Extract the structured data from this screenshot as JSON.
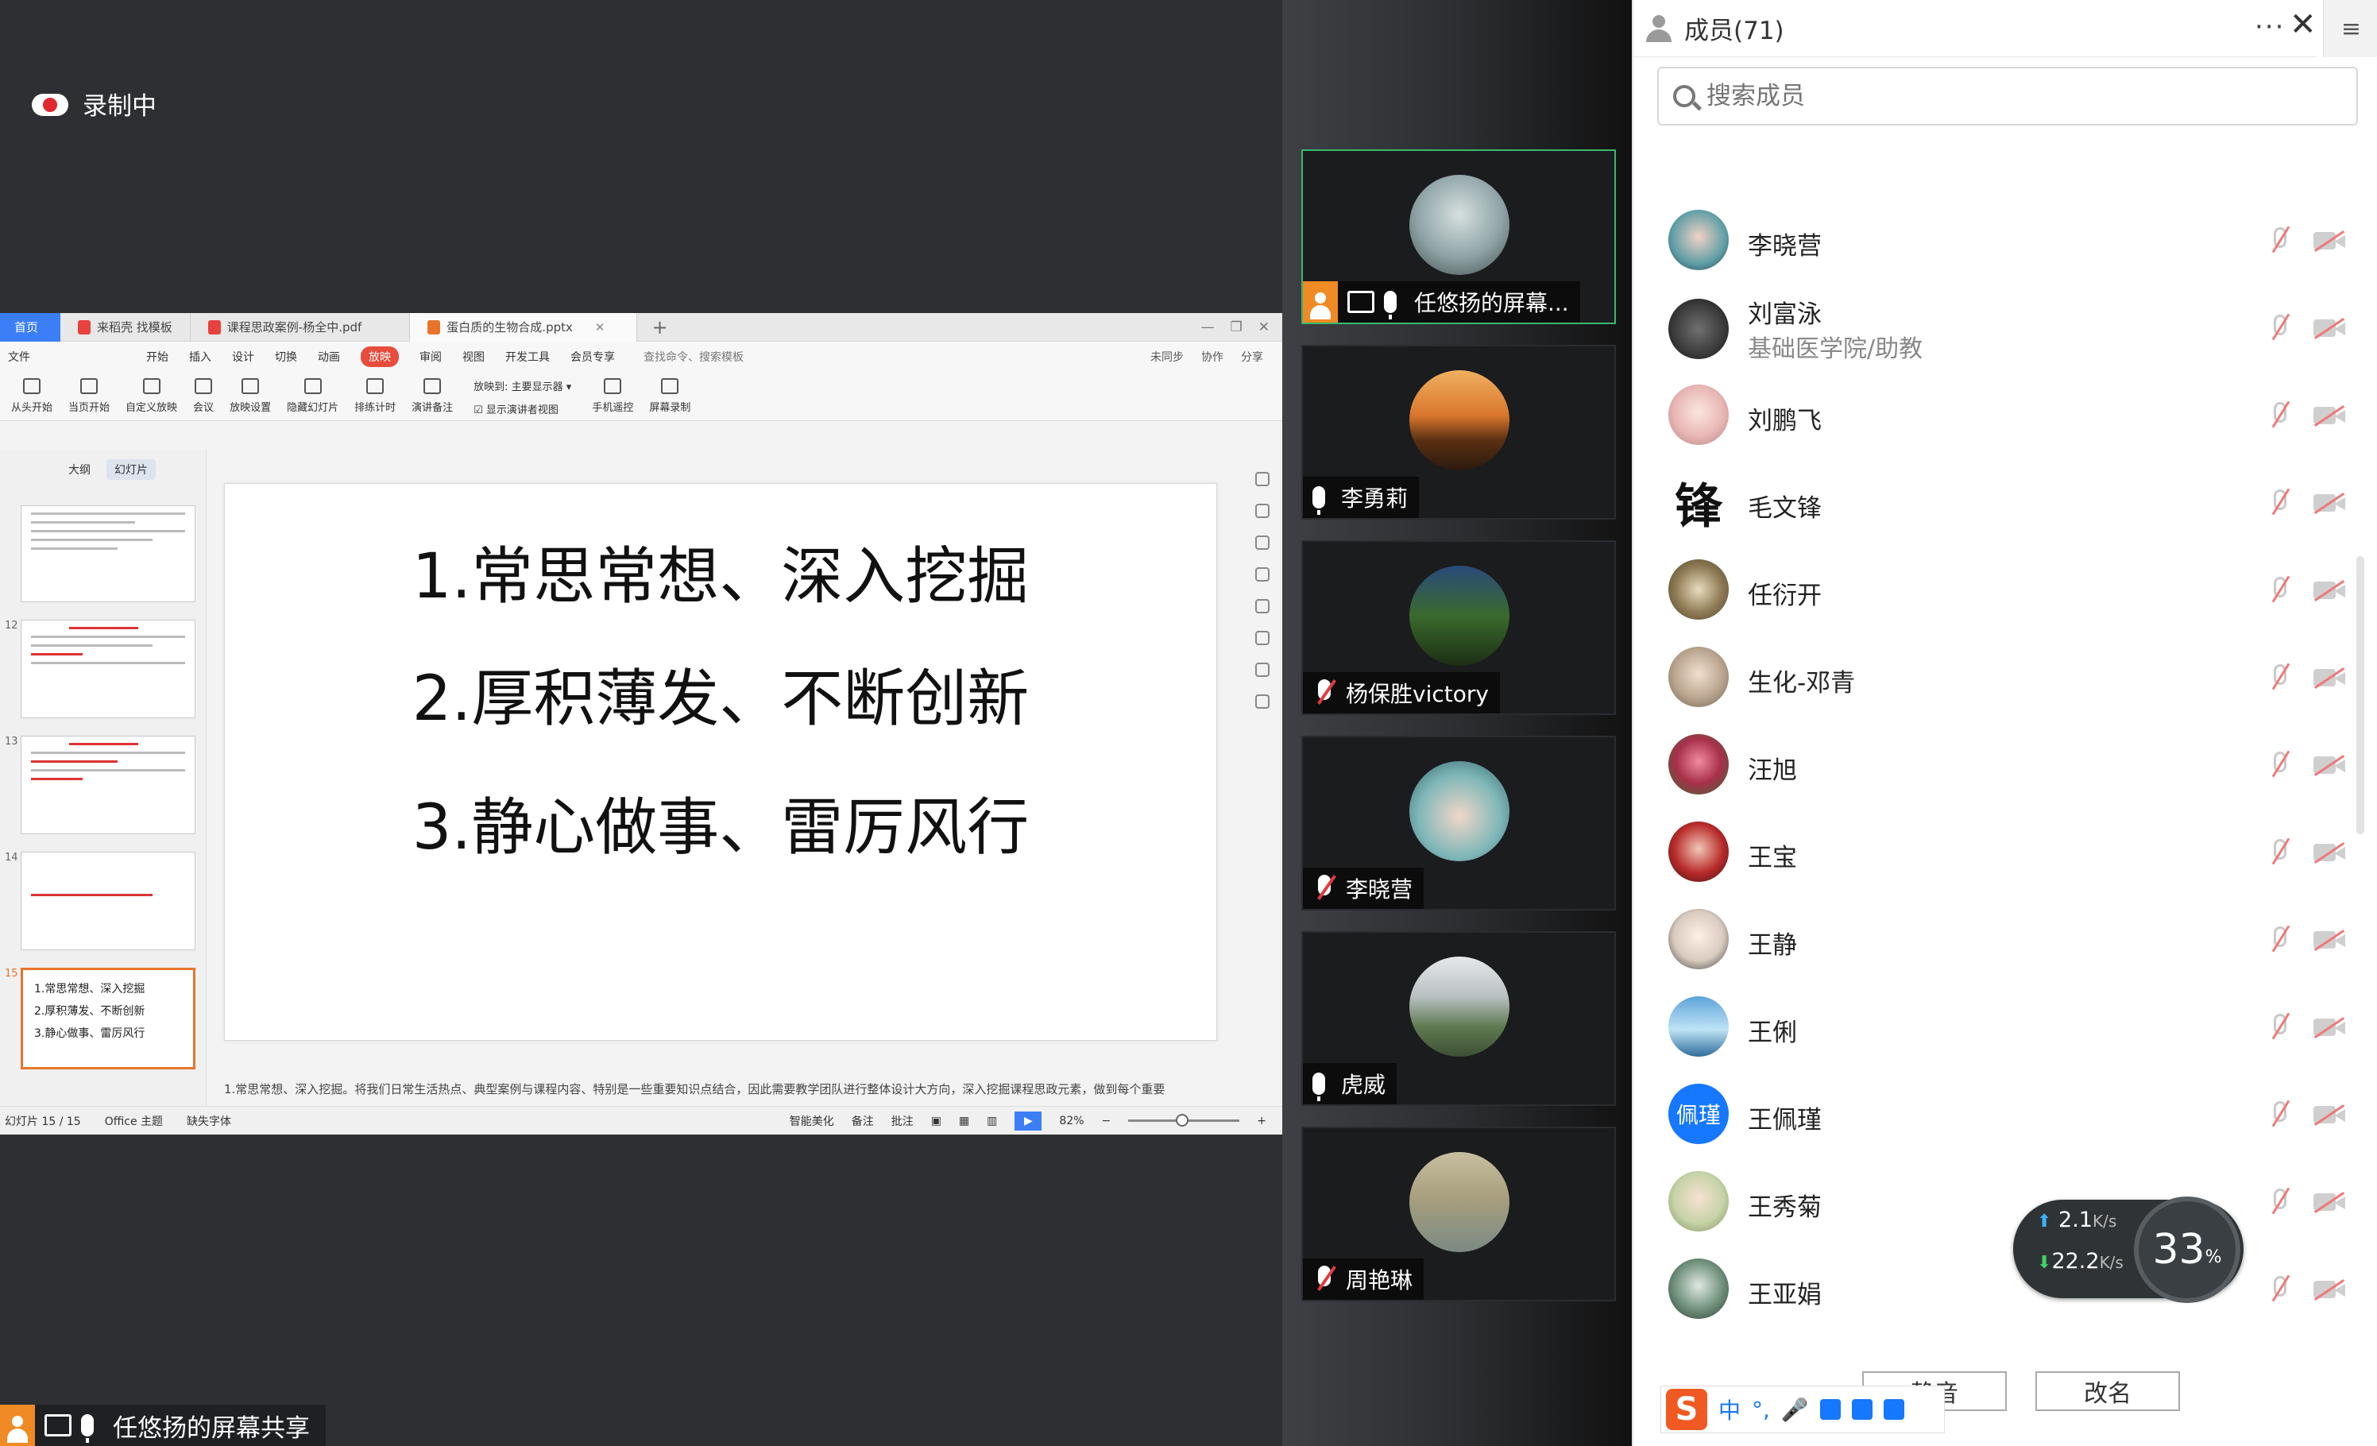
{
  "recording": {
    "label": "录制中",
    "icon": "cloud-record-icon"
  },
  "screen_share": {
    "tabs": [
      {
        "label": "首页"
      },
      {
        "label": "来稻壳 找模板",
        "icon_color": "#e8423f"
      },
      {
        "label": "课程思政案例-杨全中.pdf",
        "icon_color": "#e8423f"
      },
      {
        "label": "蛋白质的生物合成.pptx",
        "icon_color": "#e8742b"
      }
    ],
    "menu": [
      "文件",
      "开始",
      "插入",
      "设计",
      "切换",
      "动画",
      "放映",
      "审阅",
      "视图",
      "开发工具",
      "会员专享"
    ],
    "menu_selected": "放映",
    "search_cmd": "查找命令、搜索模板",
    "menu_right": [
      "未同步",
      "协作",
      "分享"
    ],
    "ribbon": [
      "从头开始",
      "当页开始",
      "自定义放映",
      "会议",
      "放映设置",
      "隐藏幻灯片",
      "排练计时",
      "演讲备注",
      "手机遥控",
      "屏幕录制"
    ],
    "ribbon_group": {
      "display_label": "放映到:",
      "display_value": "主要显示器",
      "presenter_view": "显示演讲者视图"
    },
    "pane_tabs": [
      "大纲",
      "幻灯片"
    ],
    "thumb_numbers": [
      "12",
      "13",
      "14",
      "15"
    ],
    "thumb_selected_lines": [
      "1.常思常想、深入挖掘",
      "2.厚积薄发、不断创新",
      "3.静心做事、雷厉风行"
    ],
    "slide_lines": [
      "1.常思常想、深入挖掘",
      "2.厚积薄发、不断创新",
      "3.静心做事、雷厉风行"
    ],
    "notes": "1.常思常想、深入挖掘。将我们日常生活热点、典型案例与课程内容、特别是一些重要知识点结合，因此需要教学团队进行整体设计大方向，深入挖掘课程思政元素，做到每个重要",
    "status": {
      "slide_counter": "幻灯片 15 / 15",
      "theme": "Office 主题",
      "missing_font": "缺失字体",
      "smart_beautify": "智能美化",
      "notes_label": "备注",
      "comments_label": "批注",
      "zoom": "82%"
    }
  },
  "sharer_bar": {
    "label": "任悠扬的屏幕共享"
  },
  "video_tiles": [
    {
      "name": "任悠扬的屏幕...",
      "muted": false,
      "sharing": true,
      "avatar_color": "#8ea3a6"
    },
    {
      "name": "李勇莉",
      "muted": false,
      "sharing": false,
      "avatar_color": "#d9772d"
    },
    {
      "name": "杨保胜victory",
      "muted": true,
      "sharing": false,
      "avatar_color": "#3a6a2d"
    },
    {
      "name": "李晓营",
      "muted": true,
      "sharing": false,
      "avatar_color": "#4c8f95"
    },
    {
      "name": "虎威",
      "muted": false,
      "sharing": false,
      "avatar_color": "#5f7a52"
    },
    {
      "name": "周艳琳",
      "muted": true,
      "sharing": false,
      "avatar_color": "#a89f7e"
    }
  ],
  "members_panel": {
    "title": "成员(71)",
    "search_placeholder": "搜索成员",
    "members": [
      {
        "name": "李晓营",
        "sub": "",
        "avatar_color": "#356b74"
      },
      {
        "name": "刘富泳",
        "sub": "基础医学院/助教",
        "avatar_color": "#3a3a3a"
      },
      {
        "name": "刘鹏飞",
        "sub": "",
        "avatar_color": "#e8b7b5"
      },
      {
        "name": "毛文锋",
        "sub": "",
        "avatar_color": "#ffffff",
        "glyph": "锋"
      },
      {
        "name": "任衍开",
        "sub": "",
        "avatar_color": "#8e7a54"
      },
      {
        "name": "生化-邓青",
        "sub": "",
        "avatar_color": "#b9a48e"
      },
      {
        "name": "汪旭",
        "sub": "",
        "avatar_color": "#a8304a"
      },
      {
        "name": "王宝",
        "sub": "",
        "avatar_color": "#b82a2a"
      },
      {
        "name": "王静",
        "sub": "",
        "avatar_color": "#d9cbbf"
      },
      {
        "name": "王俐",
        "sub": "",
        "avatar_color": "#5ea3d9"
      },
      {
        "name": "王佩瑾",
        "sub": "",
        "avatar_color": "#1677ff",
        "initials": "佩瑾"
      },
      {
        "name": "王秀菊",
        "sub": "",
        "avatar_color": "#c7d3a8"
      },
      {
        "name": "王亚娟",
        "sub": "",
        "avatar_color": "#6e8f7a"
      }
    ],
    "network": {
      "up": "2.1",
      "down": "22.2",
      "unit": "K/s",
      "cpu": "33",
      "pct": "%"
    },
    "buttons": {
      "mute": "静音",
      "rename": "改名"
    },
    "ime": {
      "logo": "S",
      "mode": "中",
      "punct": "°,"
    }
  }
}
